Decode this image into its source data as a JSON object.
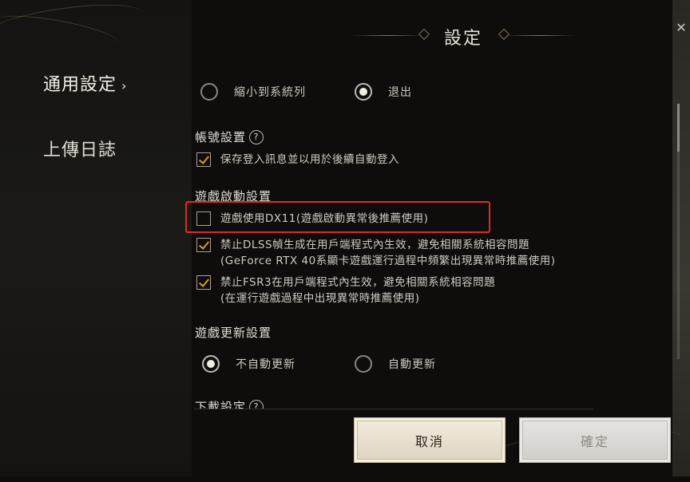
{
  "window": {
    "title": "設定",
    "close_glyph": "✕"
  },
  "sidebar": {
    "items": [
      {
        "label": "通用設定",
        "active": true
      },
      {
        "label": "上傳日誌",
        "active": false
      }
    ],
    "chevron": "›"
  },
  "close_behavior": {
    "options": [
      {
        "label": "縮小到系統列",
        "selected": false
      },
      {
        "label": "退出",
        "selected": true
      }
    ]
  },
  "account_settings": {
    "title": "帳號設置",
    "help": "?",
    "save_login": {
      "label": "保存登入訊息並以用於後續自動登入",
      "checked": true
    }
  },
  "launch_settings": {
    "title": "遊戲啟動設置",
    "dx11": {
      "label": "遊戲使用DX11(遊戲啟動異常後推薦使用)",
      "checked": false
    },
    "dlss": {
      "line1": "禁止DLSS幀生成在用戶端程式內生效，避免相關系統相容問題",
      "line2": "(GeForce RTX 40系顯卡遊戲運行過程中頻繁出現異常時推薦使用)",
      "checked": true
    },
    "fsr3": {
      "line1": "禁止FSR3在用戶端程式內生效，避免相關系統相容問題",
      "line2": "(在運行遊戲過程中出現異常時推薦使用)",
      "checked": true
    }
  },
  "update_settings": {
    "title": "遊戲更新設置",
    "options": [
      {
        "label": "不自動更新",
        "selected": true
      },
      {
        "label": "自動更新",
        "selected": false
      }
    ]
  },
  "download_settings": {
    "title": "下載設定",
    "help": "?"
  },
  "buttons": {
    "cancel": "取消",
    "confirm": "確定"
  },
  "colors": {
    "checkmark": "#d99b2a",
    "highlight": "#e0282c"
  }
}
